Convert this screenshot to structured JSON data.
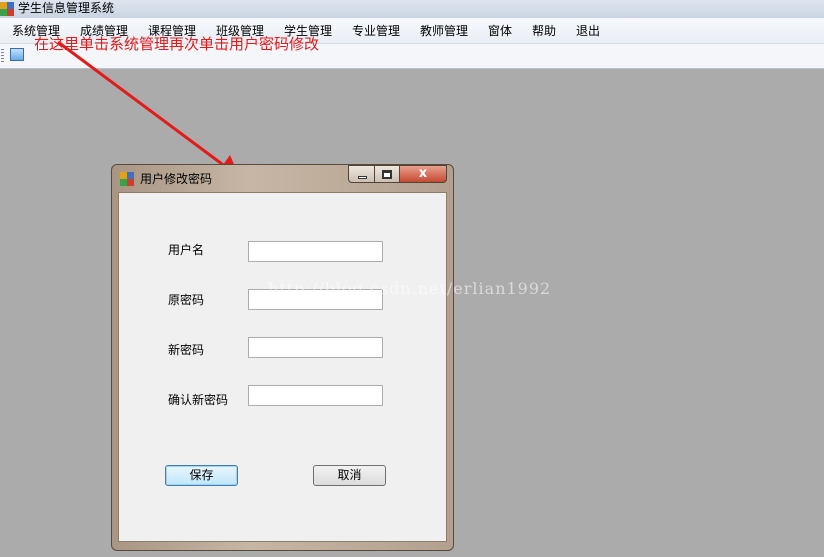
{
  "window": {
    "title": "学生信息管理系统"
  },
  "menu": [
    "系统管理",
    "成绩管理",
    "课程管理",
    "班级管理",
    "学生管理",
    "专业管理",
    "教师管理",
    "窗体",
    "帮助",
    "退出"
  ],
  "annotation": "在这里单击系统管理再次单击用户密码修改",
  "watermark": "http://blog.csdn.net/erlian1992",
  "colors": {
    "annotation": "#e21b1b",
    "workspace": "#ababab",
    "dialog_frame": "#c7b6a5",
    "close_button": "#c44a31"
  },
  "dialog": {
    "title": "用户修改密码",
    "fields": [
      {
        "label": "用户名",
        "value": ""
      },
      {
        "label": "原密码",
        "value": ""
      },
      {
        "label": "新密码",
        "value": ""
      },
      {
        "label": "确认新密码",
        "value": ""
      }
    ],
    "save_label": "保存",
    "cancel_label": "取消",
    "close_glyph": "x"
  }
}
